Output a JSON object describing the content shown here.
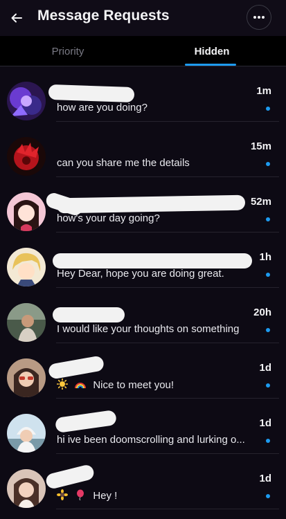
{
  "header": {
    "title": "Message Requests",
    "back_icon": "arrow-left-icon",
    "more_icon": "more-dots-icon"
  },
  "tabs": [
    {
      "label": "Priority",
      "active": false
    },
    {
      "label": "Hidden",
      "active": true
    }
  ],
  "accent_color": "#1d9bf0",
  "requests": [
    {
      "time": "1m",
      "message": "how are you doing?",
      "unread": true
    },
    {
      "time": "15m",
      "message": "can you share me the details",
      "unread": true
    },
    {
      "time": "52m",
      "message": "how's your day going?",
      "unread": true
    },
    {
      "time": "1h",
      "message": "Hey Dear, hope you are doing great.",
      "unread": true
    },
    {
      "time": "20h",
      "message": "I would like your thoughts on something",
      "unread": true
    },
    {
      "time": "1d",
      "message": "Nice to meet you!",
      "prefix_icons": [
        "sun-emoji-icon",
        "rainbow-emoji-icon"
      ],
      "unread": true
    },
    {
      "time": "1d",
      "message": "hi ive been doomscrolling and lurking o...",
      "unread": true
    },
    {
      "time": "1d",
      "message": "Hey !",
      "prefix_icons": [
        "sunflower-emoji-icon",
        "balloon-emoji-icon"
      ],
      "unread": true
    }
  ]
}
